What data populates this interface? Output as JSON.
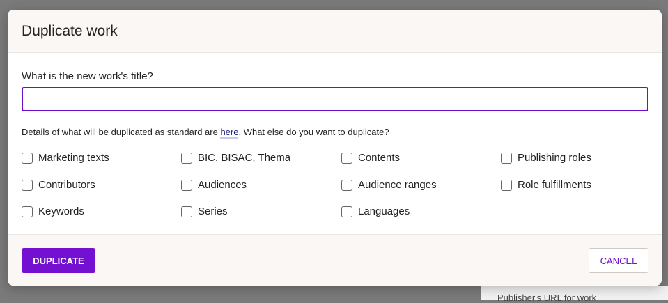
{
  "background": {
    "partial_text": "Publisher's URL for work"
  },
  "modal": {
    "title": "Duplicate work",
    "title_label": "What is the new work's title?",
    "title_input_value": "",
    "details_prefix": "Details of what will be duplicated as standard are ",
    "details_link": "here",
    "details_suffix": ". What else do you want to duplicate?",
    "options": [
      {
        "label": "Marketing texts",
        "checked": false
      },
      {
        "label": "BIC, BISAC, Thema",
        "checked": false
      },
      {
        "label": "Contents",
        "checked": false
      },
      {
        "label": "Publishing roles",
        "checked": false
      },
      {
        "label": "Contributors",
        "checked": false
      },
      {
        "label": "Audiences",
        "checked": false
      },
      {
        "label": "Audience ranges",
        "checked": false
      },
      {
        "label": "Role fulfillments",
        "checked": false
      },
      {
        "label": "Keywords",
        "checked": false
      },
      {
        "label": "Series",
        "checked": false
      },
      {
        "label": "Languages",
        "checked": false
      }
    ],
    "duplicate_label": "DUPLICATE",
    "cancel_label": "CANCEL"
  },
  "colors": {
    "accent": "#7410cf",
    "overlay": "#7a7a7a",
    "header_bg": "#fbf7f5"
  }
}
